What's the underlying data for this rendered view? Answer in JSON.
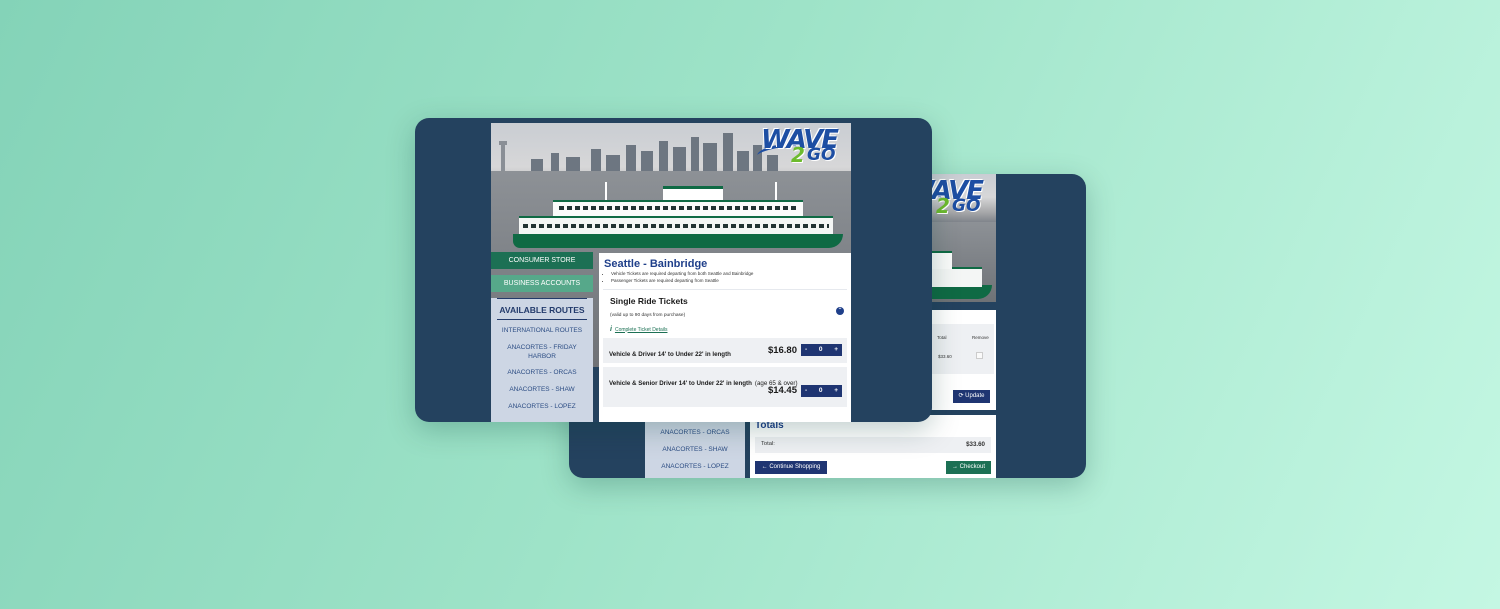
{
  "back_card": {
    "cart": {
      "col_total": "Total",
      "col_remove": "Remove",
      "line_total": "$33.60",
      "update_label": "Update",
      "update_icon": "refresh-icon"
    },
    "routes": [
      "ANACORTES - ORCAS",
      "ANACORTES - SHAW",
      "ANACORTES - LOPEZ"
    ],
    "totals": {
      "title": "Totals",
      "total_label": "Total:",
      "total_value": "$33.60",
      "continue_label": "Continue Shopping",
      "checkout_label": "Checkout"
    },
    "logo": {
      "wave": "WAVE",
      "two": "2",
      "go": "GO"
    }
  },
  "front_card": {
    "logo": {
      "wave": "WAVE",
      "two": "2",
      "go": "GO"
    },
    "sidebar": {
      "consumer_store": "CONSUMER STORE",
      "business_accounts": "BUSINESS ACCOUNTS",
      "available_routes_title": "AVAILABLE ROUTES",
      "routes": [
        "INTERNATIONAL ROUTES",
        "ANACORTES - FRIDAY HARBOR",
        "ANACORTES - ORCAS",
        "ANACORTES - SHAW",
        "ANACORTES - LOPEZ"
      ]
    },
    "main": {
      "route_title": "Seattle - Bainbridge",
      "notes": [
        "Vehicle Tickets are required departing from both Seattle and Bainbridge",
        "Passenger Tickets are required departing from Seattle"
      ],
      "section_title": "Single Ride Tickets",
      "valid_text": "(valid up to 90 days from purchase)",
      "details_link": "Complete Ticket Details",
      "tickets": [
        {
          "label": "Vehicle & Driver 14' to Under 22' in length",
          "note": "",
          "price": "$16.80",
          "qty": "0"
        },
        {
          "label": "Vehicle & Senior Driver 14' to Under 22' in length",
          "note": "(age 65 & over)",
          "price": "$14.45",
          "qty": "0"
        }
      ],
      "minus": "-",
      "plus": "+"
    }
  },
  "colors": {
    "background": "#9ee3c8",
    "card": "#24425f",
    "navy_accent": "#1f3572",
    "green_accent": "#1c7054",
    "title_blue": "#1f3f8a"
  }
}
